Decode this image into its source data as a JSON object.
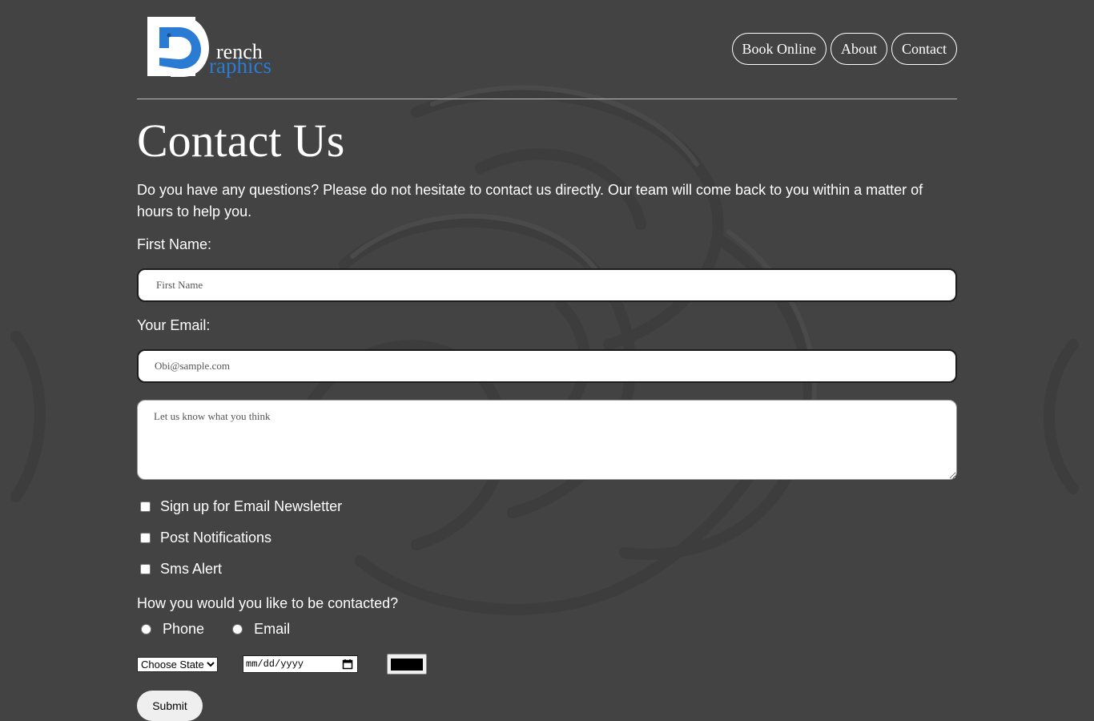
{
  "logo": {
    "text_part_1": "rench",
    "text_part_2": "raphics",
    "brand_color": "#2a7bd4"
  },
  "nav": {
    "items": [
      {
        "label": "Book Online"
      },
      {
        "label": "About"
      },
      {
        "label": "Contact"
      }
    ]
  },
  "main": {
    "title": "Contact Us",
    "intro": "Do you have any questions? Please do not hesitate to contact us directly. Our team will come back to you within a matter of hours to help you."
  },
  "form": {
    "first_name_label": "First Name:",
    "first_name_placeholder": "First Name",
    "email_label": "Your Email:",
    "email_placeholder": "Obi@sample.com",
    "message_placeholder": "Let us know what you think",
    "checkboxes": [
      {
        "label": "Sign up for Email Newsletter",
        "checked": false
      },
      {
        "label": "Post Notifications",
        "checked": false
      },
      {
        "label": "Sms Alert",
        "checked": false
      }
    ],
    "contact_question": "How you would you like to be contacted?",
    "radios": [
      {
        "label": "Phone"
      },
      {
        "label": "Email"
      }
    ],
    "state_select": "Choose State",
    "date_placeholder": "mm/dd/yyyy",
    "color_value": "#000000",
    "submit_label": "Submit"
  },
  "colors": {
    "background": "#434343",
    "text": "#ffffff"
  }
}
